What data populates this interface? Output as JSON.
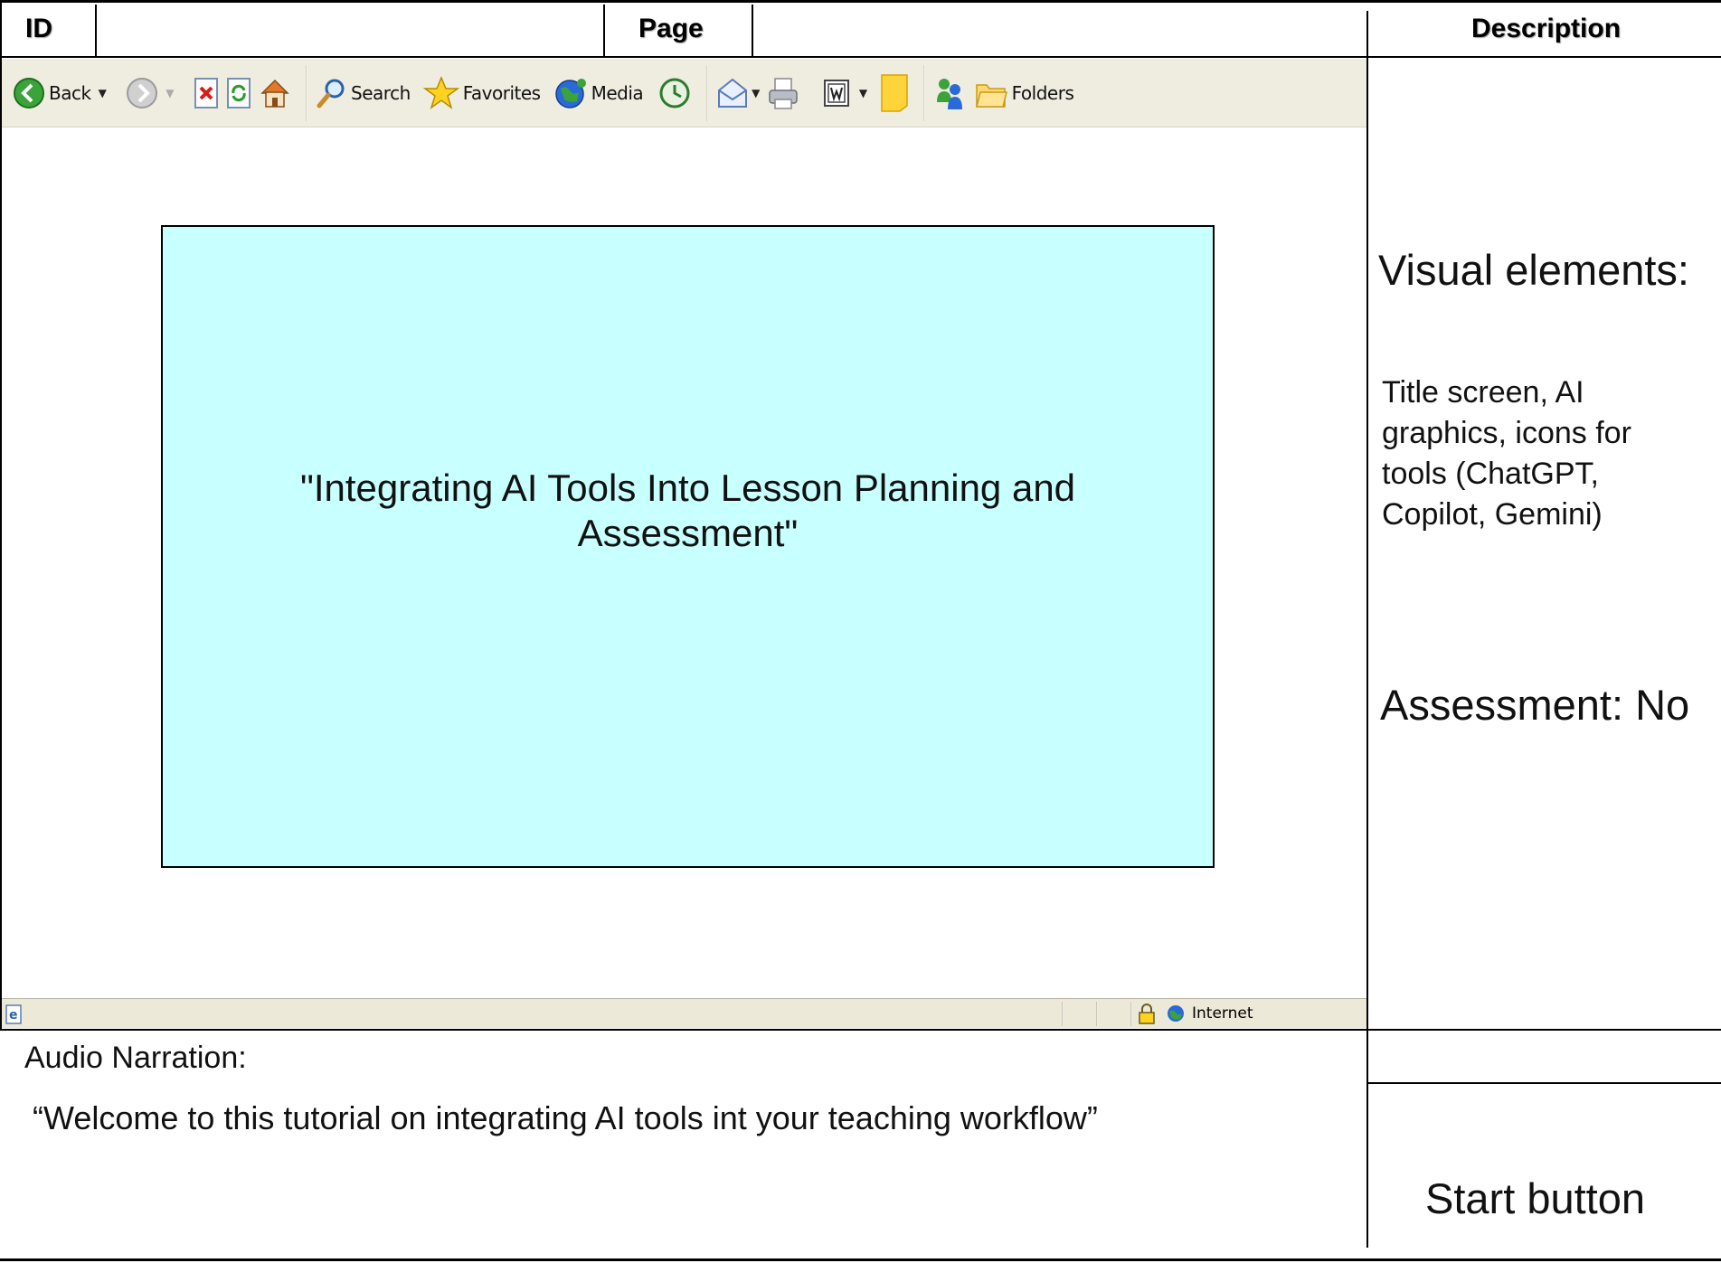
{
  "header": {
    "id_label": "ID",
    "page_label": "Page",
    "description_label": "Description"
  },
  "toolbar": {
    "back_label": "Back",
    "search_label": "Search",
    "favorites_label": "Favorites",
    "media_label": "Media",
    "folders_label": "Folders"
  },
  "slide": {
    "title": "\"Integrating AI Tools Into Lesson Planning and Assessment\""
  },
  "statusbar": {
    "zone_label": "Internet"
  },
  "description": {
    "visual_heading": "Visual elements:",
    "visual_text": "Title screen, AI graphics, icons for tools (ChatGPT, Copilot, Gemini)",
    "assessment": "Assessment: No",
    "start_button": "Start button"
  },
  "narration": {
    "label": "Audio Narration:",
    "text": "“Welcome to this tutorial on integrating AI tools int your teaching workflow”"
  },
  "colors": {
    "slide_bg": "#c8ffff",
    "toolbar_bg": "#efede0",
    "status_bg": "#ece9d8"
  }
}
